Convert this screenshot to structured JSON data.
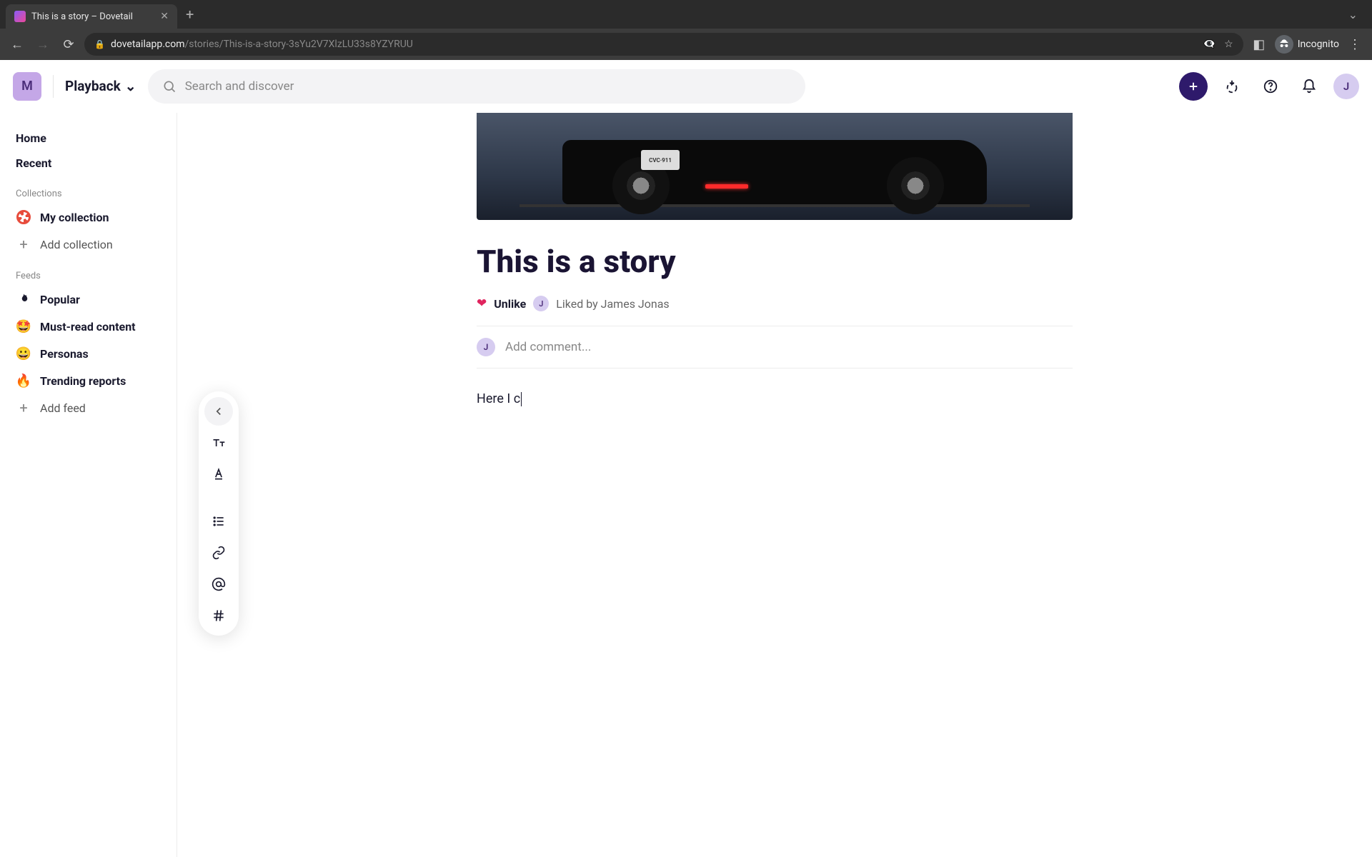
{
  "browser": {
    "tab_title": "This is a story – Dovetail",
    "url_domain": "dovetailapp.com",
    "url_path": "/stories/This-is-a-story-3sYu2V7XlzLU33s8YZYRUU",
    "incognito_label": "Incognito"
  },
  "header": {
    "workspace_initial": "M",
    "playback_label": "Playback",
    "search_placeholder": "Search and discover",
    "user_initial": "J"
  },
  "sidebar": {
    "home": "Home",
    "recent": "Recent",
    "collections_label": "Collections",
    "my_collection": "My collection",
    "add_collection": "Add collection",
    "feeds_label": "Feeds",
    "feeds": [
      {
        "emoji": "🔥",
        "label": "Popular",
        "name": "popular",
        "flame": true
      },
      {
        "emoji": "🤩",
        "label": "Must-read content",
        "name": "must-read"
      },
      {
        "emoji": "😀",
        "label": "Personas",
        "name": "personas"
      },
      {
        "emoji": "🔥",
        "label": "Trending reports",
        "name": "trending"
      }
    ],
    "add_feed": "Add feed"
  },
  "story": {
    "hero_plate": "CVC·911",
    "title": "This is a story",
    "unlike_label": "Unlike",
    "liked_by_initial": "J",
    "liked_by_text": "Liked by James Jonas",
    "comment_avatar_initial": "J",
    "comment_placeholder": "Add comment...",
    "body_text": "Here I c"
  }
}
